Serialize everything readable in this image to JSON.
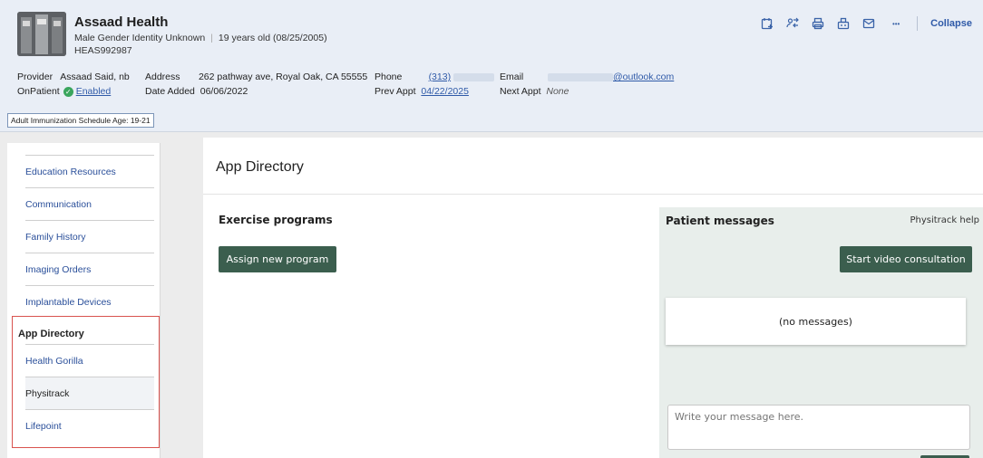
{
  "patient": {
    "name": "Assaad Health",
    "gender": "Male Gender Identity Unknown",
    "age": "19 years old (08/25/2005)",
    "id": "HEAS992987"
  },
  "toolbar": {
    "icons": [
      "calendar-add-icon",
      "people-swap-icon",
      "print-icon",
      "fax-icon",
      "mail-icon",
      "more-icon"
    ],
    "more_label": "•••",
    "collapse_label": "Collapse"
  },
  "details": {
    "provider_label": "Provider",
    "provider_value": "Assaad Said, nb",
    "address_label": "Address",
    "address_value": "262 pathway ave, Royal Oak, CA 55555",
    "phone_label": "Phone",
    "phone_value": "(313)",
    "email_label": "Email",
    "email_value": "@outlook.com",
    "onpatient_label": "OnPatient",
    "onpatient_value": "Enabled",
    "date_added_label": "Date Added",
    "date_added_value": "06/06/2022",
    "prev_appt_label": "Prev Appt",
    "prev_appt_value": "04/22/2025",
    "next_appt_label": "Next Appt",
    "next_appt_value": "None"
  },
  "schedule_badge": "Adult Immunization Schedule Age: 19-21",
  "sidebar": {
    "items": [
      {
        "label": "Education Resources"
      },
      {
        "label": "Communication"
      },
      {
        "label": "Family History"
      },
      {
        "label": "Imaging Orders"
      },
      {
        "label": "Implantable Devices"
      },
      {
        "label": "App Directory"
      },
      {
        "label": "Health Gorilla"
      },
      {
        "label": "Physitrack"
      },
      {
        "label": "Lifepoint"
      }
    ]
  },
  "main": {
    "title": "App Directory",
    "exercise_title": "Exercise programs",
    "assign_button": "Assign new program"
  },
  "messages": {
    "title": "Patient messages",
    "help_link": "Physitrack help",
    "video_button": "Start video consultation",
    "empty_text": "(no messages)",
    "input_placeholder": "Write your message here."
  },
  "colors": {
    "link": "#2f5aa8",
    "primary_button": "#3b5e4e",
    "highlight_border": "#d9534f",
    "enabled_check": "#3aa55d"
  }
}
